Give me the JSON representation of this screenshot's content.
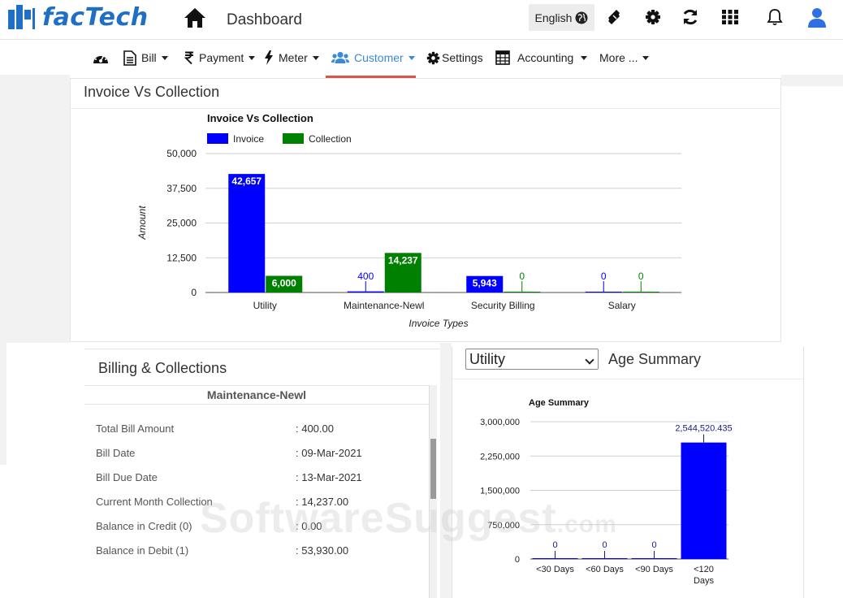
{
  "app": {
    "logo_text": "facTech",
    "page_title": "Dashboard",
    "language": "English"
  },
  "nav": {
    "items": [
      {
        "id": "dashboard",
        "label": ""
      },
      {
        "id": "bill",
        "label": "Bill"
      },
      {
        "id": "payment",
        "label": "Payment"
      },
      {
        "id": "meter",
        "label": "Meter"
      },
      {
        "id": "customer",
        "label": "Customer"
      },
      {
        "id": "settings",
        "label": "Settings"
      },
      {
        "id": "accounting",
        "label": "Accounting"
      },
      {
        "id": "more",
        "label": "More ..."
      }
    ],
    "active": "customer"
  },
  "colors": {
    "brand": "#1f6fc4",
    "invoice": "#0000ff",
    "collection": "#008000",
    "active_nav": "#3a8ad6",
    "underline": "#d9534f"
  },
  "invoice_card": {
    "title": "Invoice Vs Collection"
  },
  "billing": {
    "title": "Billing & Collections",
    "subtitle": "Maintenance-Newl",
    "rows": [
      {
        "label": "Total Bill Amount",
        "value": ": 400.00"
      },
      {
        "label": "Bill Date",
        "value": ": 09-Mar-2021"
      },
      {
        "label": "Bill Due Date",
        "value": ": 13-Mar-2021"
      },
      {
        "label": "Current Month Collection",
        "value": ": 14,237.00"
      },
      {
        "label": "Balance in Credit (0)",
        "value": ": 0.00"
      },
      {
        "label": "Balance in Debit (1)",
        "value": ": 53,930.00"
      }
    ]
  },
  "age": {
    "select_value": "Utility",
    "title": "Age Summary"
  },
  "watermark": {
    "main": "SoftwareSuggest",
    "suffix": ".com"
  },
  "chart_data": [
    {
      "type": "bar",
      "title": "Invoice Vs Collection",
      "xlabel": "Invoice Types",
      "ylabel": "Amount",
      "categories": [
        "Utility",
        "Maintenance-Newl",
        "Security Billing",
        "Salary"
      ],
      "series": [
        {
          "name": "Invoice",
          "values": [
            42657,
            400,
            5943,
            0
          ],
          "labels": [
            "42,657",
            "400",
            "5,943",
            "0"
          ]
        },
        {
          "name": "Collection",
          "values": [
            6000,
            14237,
            0,
            0
          ],
          "labels": [
            "6,000",
            "14,237",
            "0",
            "0"
          ]
        }
      ],
      "yticks": [
        0,
        12500,
        25000,
        37500,
        50000
      ],
      "ytick_labels": [
        "0",
        "12,500",
        "25,000",
        "37,500",
        "50,000"
      ],
      "ylim": [
        0,
        50000
      ],
      "legend": "top-left",
      "grid": true
    },
    {
      "type": "bar",
      "title": "Age Summary",
      "categories": [
        "<30 Days",
        "<60 Days",
        "<90 Days",
        "<120 Days"
      ],
      "values": [
        0,
        0,
        0,
        2544520.435
      ],
      "labels": [
        "0",
        "0",
        "0",
        "2,544,520.435"
      ],
      "yticks": [
        0,
        750000,
        1500000,
        2250000,
        3000000
      ],
      "ytick_labels": [
        "0",
        "750,000",
        "1,500,000",
        "2,250,000",
        "3,000,000"
      ],
      "ylim": [
        0,
        3000000
      ],
      "grid": true
    }
  ]
}
